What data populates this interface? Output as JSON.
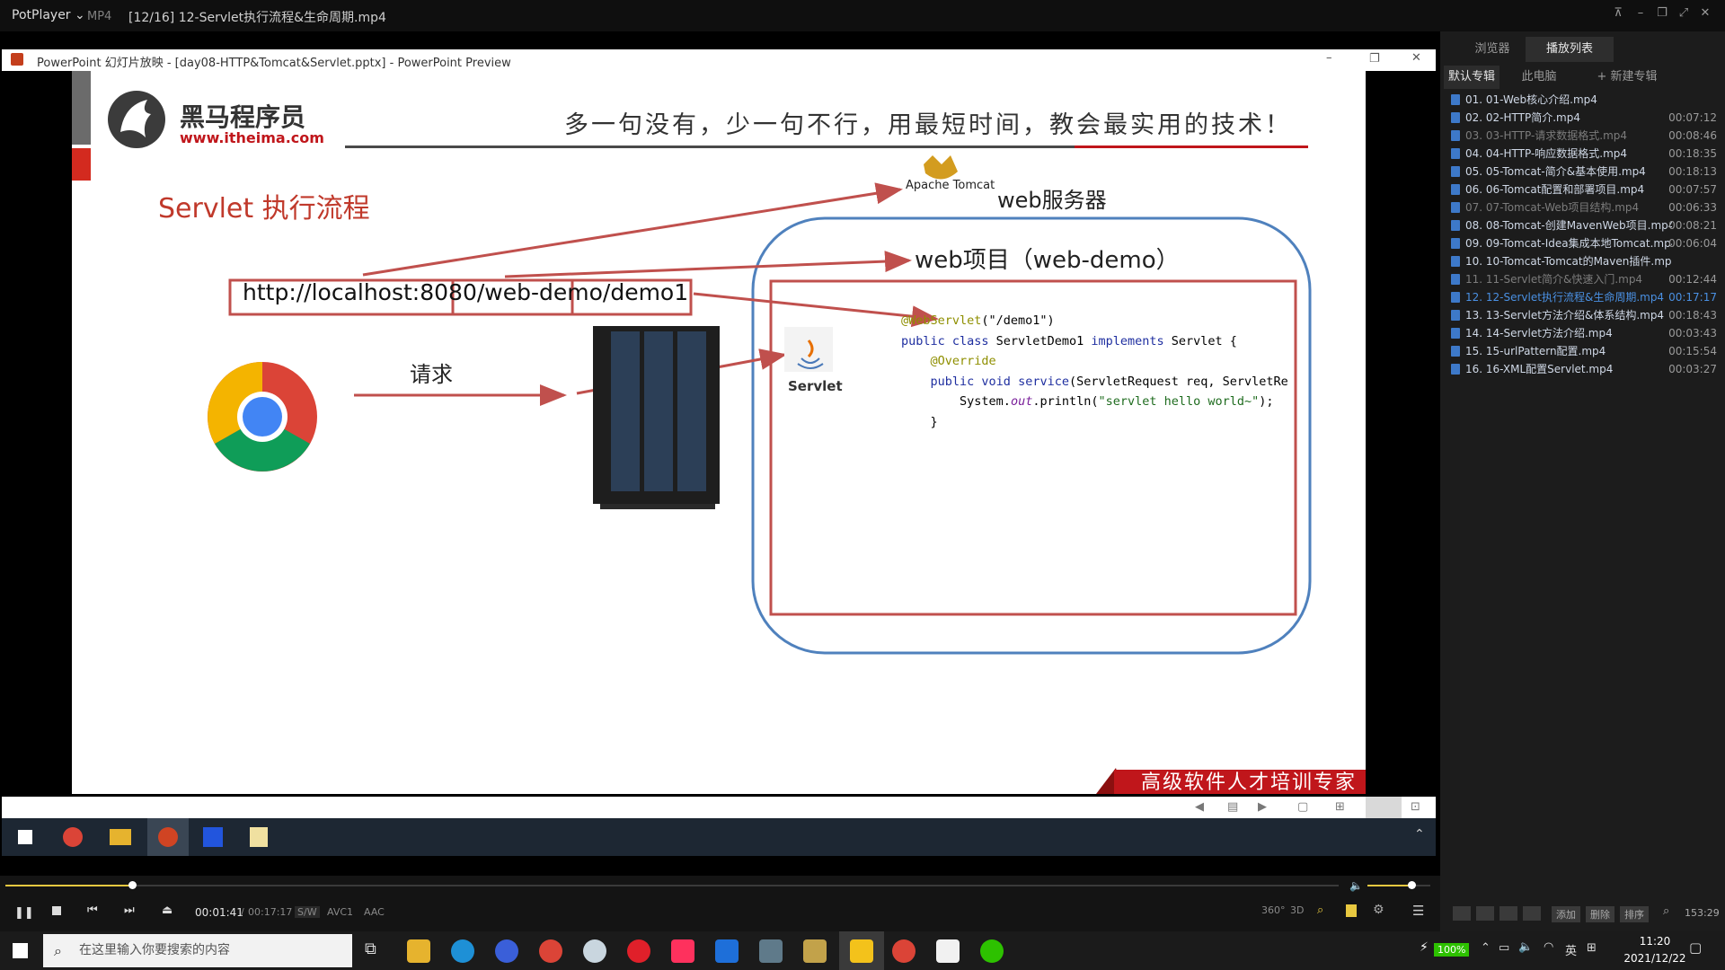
{
  "player": {
    "app_name": "PotPlayer",
    "format": "MP4",
    "file_title": "[12/16] 12-Servlet执行流程&生命周期.mp4",
    "time_current": "00:01:41",
    "time_total": "00:17:17",
    "tags": [
      "S/W",
      "AVC1",
      "AAC"
    ],
    "progress": 0.095,
    "volume": 0.7,
    "badge_360": "360°",
    "badge_3d": "3D"
  },
  "ppt": {
    "window_title": "PowerPoint 幻灯片放映 - [day08-HTTP&Tomcat&Servlet.pptx] - PowerPoint Preview",
    "brand_cn": "黑马程序员",
    "brand_url": "www.itheima.com",
    "slogan": "多一句没有，少一句不行，用最短时间，教会最实用的技术！",
    "slide_title": "Servlet 执行流程",
    "tomcat_label": "Apache Tomcat",
    "web_server": "web服务器",
    "web_project": "web项目（web-demo）",
    "url_part1": "http://localhost:8080",
    "url_part2": "/web-demo",
    "url_part3": "/demo1",
    "request_label": "请求",
    "servlet_label": "Servlet",
    "code": {
      "l1a": "@WebServlet",
      "l1b": "(\"/demo1\")",
      "l2a": "public class ",
      "l2b": "ServletDemo1 ",
      "l2c": "implements ",
      "l2d": "Servlet {",
      "l3": "@Override",
      "l4a": "public void ",
      "l4b": "service",
      "l4c": "(ServletRequest req, ServletRe",
      "l5a": "System.",
      "l5b": "out",
      "l5c": ".println(",
      "l5d": "\"servlet hello world~\"",
      "l5e": ");",
      "l6": "}"
    },
    "ribbon": "高级软件人才培训专家"
  },
  "sidebar": {
    "tabs": [
      "浏览器",
      "播放列表"
    ],
    "subtabs": [
      "默认专辑",
      "此电脑",
      "+ 新建专辑"
    ],
    "items": [
      {
        "name": "01. 01-Web核心介绍.mp4",
        "duration": ""
      },
      {
        "name": "02. 02-HTTP简介.mp4",
        "duration": "00:07:12"
      },
      {
        "name": "03. 03-HTTP-请求数据格式.mp4",
        "duration": "00:08:46"
      },
      {
        "name": "04. 04-HTTP-响应数据格式.mp4",
        "duration": "00:18:35"
      },
      {
        "name": "05. 05-Tomcat-简介&基本使用.mp4",
        "duration": "00:18:13"
      },
      {
        "name": "06. 06-Tomcat配置和部署项目.mp4",
        "duration": "00:07:57"
      },
      {
        "name": "07. 07-Tomcat-Web项目结构.mp4",
        "duration": "00:06:33"
      },
      {
        "name": "08. 08-Tomcat-创建MavenWeb项目.mp4",
        "duration": "00:08:21"
      },
      {
        "name": "09. 09-Tomcat-Idea集成本地Tomcat.mp4",
        "duration": "00:06:04"
      },
      {
        "name": "10. 10-Tomcat-Tomcat的Maven插件.mp4",
        "duration": ""
      },
      {
        "name": "11. 11-Servlet简介&快速入门.mp4",
        "duration": "00:12:44"
      },
      {
        "name": "12. 12-Servlet执行流程&生命周期.mp4",
        "duration": "00:17:17"
      },
      {
        "name": "13. 13-Servlet方法介绍&体系结构.mp4",
        "duration": "00:18:43"
      },
      {
        "name": "14. 14-Servlet方法介绍.mp4",
        "duration": "00:03:43"
      },
      {
        "name": "15. 15-urlPattern配置.mp4",
        "duration": "00:15:54"
      },
      {
        "name": "16. 16-XML配置Servlet.mp4",
        "duration": "00:03:27"
      }
    ],
    "buttons": [
      "添加",
      "删除",
      "排序"
    ],
    "total_time": "153:29"
  },
  "taskbar": {
    "search_placeholder": "在这里输入你要搜索的内容",
    "battery": "100%",
    "ime": "英",
    "time": "11:20",
    "date": "2021/12/22"
  }
}
